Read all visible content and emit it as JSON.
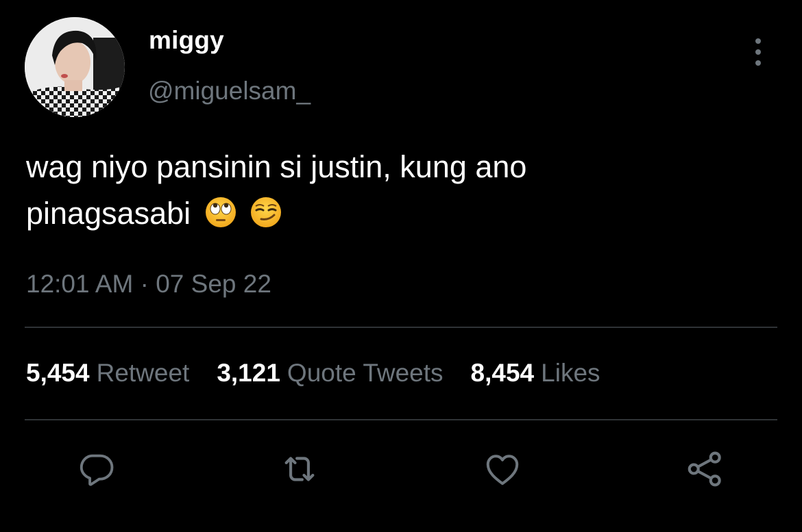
{
  "user": {
    "display_name": "miggy",
    "handle": "@miguelsam_"
  },
  "tweet": {
    "text_line1": "wag niyo pansinin si justin, kung ano",
    "text_line2": "pinagsasabi",
    "emojis": [
      "face-with-rolling-eyes",
      "smirking-face"
    ],
    "timestamp": "12:01 AM · 07 Sep 22"
  },
  "stats": [
    {
      "count": "5,454",
      "label": "Retweet"
    },
    {
      "count": "3,121",
      "label": "Quote Tweets"
    },
    {
      "count": "8,454",
      "label": "Likes"
    }
  ],
  "actions": [
    "reply-icon",
    "retweet-icon",
    "like-icon",
    "share-icon"
  ],
  "colors": {
    "background": "#000000",
    "primary_text": "#ffffff",
    "secondary_text": "#6e767d",
    "divider": "#2f3336"
  }
}
